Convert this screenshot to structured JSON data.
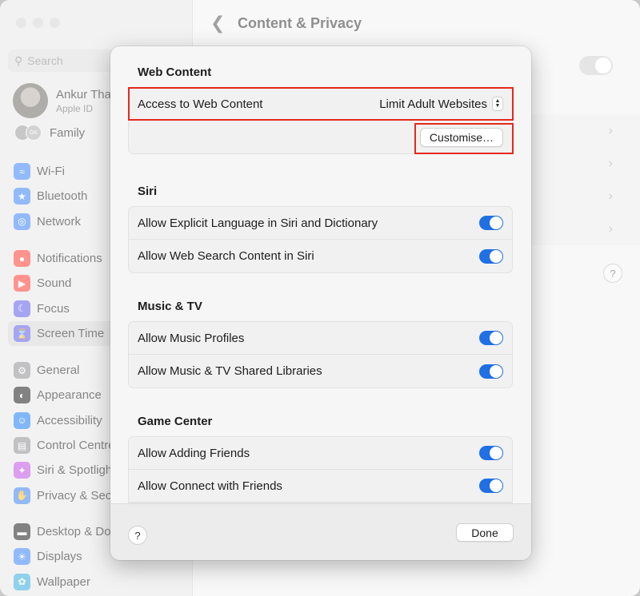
{
  "window": {
    "traffic_lights": [
      "#fe5f57",
      "#febc2e",
      "#28c840"
    ]
  },
  "sidebar": {
    "search_placeholder": "Search",
    "account": {
      "name": "Ankur Tha",
      "subtitle": "Apple ID"
    },
    "family": {
      "label": "Family",
      "avatar_initials": "GK"
    },
    "groups": [
      [
        {
          "label": "Wi-Fi",
          "icon": "wifi-icon",
          "color": "#3a82f7"
        },
        {
          "label": "Bluetooth",
          "icon": "bluetooth-icon",
          "color": "#3a82f7"
        },
        {
          "label": "Network",
          "icon": "globe-icon",
          "color": "#3a82f7"
        }
      ],
      [
        {
          "label": "Notifications",
          "icon": "bell-icon",
          "color": "#ff3b30"
        },
        {
          "label": "Sound",
          "icon": "speaker-icon",
          "color": "#ff3b30"
        },
        {
          "label": "Focus",
          "icon": "moon-icon",
          "color": "#5e5ce6"
        },
        {
          "label": "Screen Time",
          "icon": "hourglass-icon",
          "color": "#5e5ce6",
          "active": true
        }
      ],
      [
        {
          "label": "General",
          "icon": "gear-icon",
          "color": "#8e8e93"
        },
        {
          "label": "Appearance",
          "icon": "appearance-icon",
          "color": "#1c1c1e"
        },
        {
          "label": "Accessibility",
          "icon": "accessibility-icon",
          "color": "#1a7cf5"
        },
        {
          "label": "Control Centre",
          "icon": "control-centre-icon",
          "color": "#8e8e93"
        },
        {
          "label": "Siri & Spotlight",
          "icon": "siri-icon",
          "color": "#c04fe0"
        },
        {
          "label": "Privacy & Security",
          "icon": "hand-icon",
          "color": "#3a82f7"
        }
      ],
      [
        {
          "label": "Desktop & Dock",
          "icon": "dock-icon",
          "color": "#1c1c1e"
        },
        {
          "label": "Displays",
          "icon": "sun-icon",
          "color": "#3a82f7"
        },
        {
          "label": "Wallpaper",
          "icon": "flower-icon",
          "color": "#34aadc"
        }
      ]
    ]
  },
  "content": {
    "title": "Content & Privacy",
    "help": "?"
  },
  "sheet": {
    "web_content": {
      "title": "Web Content",
      "access_label": "Access to Web Content",
      "access_value": "Limit Adult Websites",
      "customise_label": "Customise…"
    },
    "siri": {
      "title": "Siri",
      "rows": [
        {
          "label": "Allow Explicit Language in Siri and Dictionary",
          "on": true
        },
        {
          "label": "Allow Web Search Content in Siri",
          "on": true
        }
      ]
    },
    "music_tv": {
      "title": "Music & TV",
      "rows": [
        {
          "label": "Allow Music Profiles",
          "on": true
        },
        {
          "label": "Allow Music & TV Shared Libraries",
          "on": true
        }
      ]
    },
    "game_center": {
      "title": "Game Center",
      "rows": [
        {
          "label": "Allow Adding Friends",
          "on": true
        },
        {
          "label": "Allow Connect with Friends",
          "on": true
        }
      ]
    },
    "footer": {
      "help": "?",
      "done_label": "Done"
    },
    "accent_color": "#1f6fe5",
    "highlight_color": "#e5281f"
  }
}
